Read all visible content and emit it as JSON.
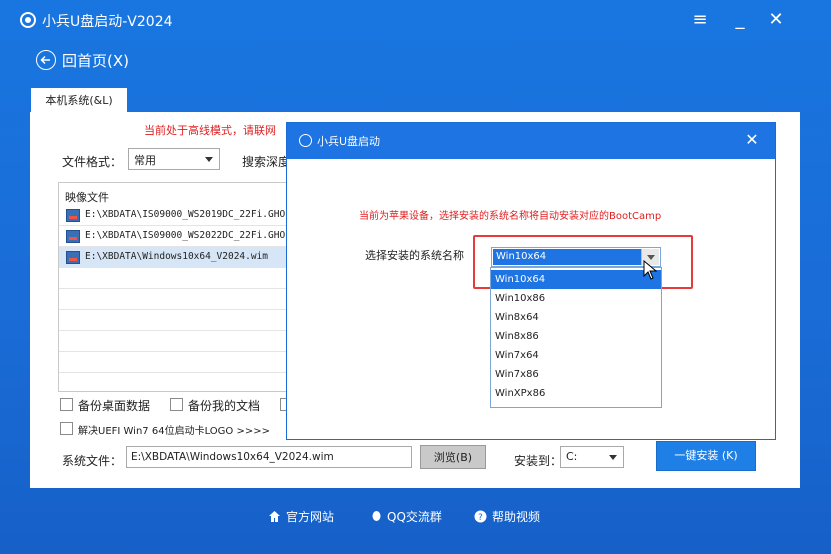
{
  "app": {
    "title": "小兵U盘启动-V2024"
  },
  "window_controls": {
    "menu": "≡",
    "minimize": "_",
    "close": "✕"
  },
  "nav": {
    "back_label": "回首页(X)"
  },
  "tabs": [
    {
      "label": "本机系统(&L)"
    }
  ],
  "main": {
    "warning": "当前处于高线模式，请联网",
    "file_format_label": "文件格式：",
    "file_format_value": "常用",
    "search_depth_label": "搜索深度",
    "list_header": "映像文件",
    "files": [
      "E:\\XBDATA\\IS09000_WS2019DC_22Fi.GHO",
      "E:\\XBDATA\\IS09000_WS2022DC_22Fi.GHO",
      "E:\\XBDATA\\Windows10x64_V2024.wim"
    ],
    "backup_desktop": "备份桌面数据",
    "backup_docs": "备份我的文档",
    "fix_uefi": "解决UEFI Win7 64位启动卡LOGO >>>>",
    "system_file_label": "系统文件：",
    "system_file_value": "E:\\XBDATA\\Windows10x64_V2024.wim",
    "browse_label": "浏览(B)",
    "install_to_label": "安装到：",
    "install_to_value": "C:",
    "install_button": "一键安装 (K)"
  },
  "dialog": {
    "title": "小兵U盘启动",
    "warning": "当前为苹果设备，选择安装的系统名称将自动安装对应的BootCamp",
    "select_label": "选择安装的系统名称",
    "selected": "Win10x64",
    "options": [
      "Win10x64",
      "Win10x86",
      "Win8x64",
      "Win8x86",
      "Win7x64",
      "Win7x86",
      "WinXPx86"
    ]
  },
  "footer": {
    "website": "官方网站",
    "qq_group": "QQ交流群",
    "help_video": "帮助视频"
  },
  "colors": {
    "primary": "#1a6bd6",
    "warning": "#e02020",
    "highlight": "#1e74e2"
  }
}
